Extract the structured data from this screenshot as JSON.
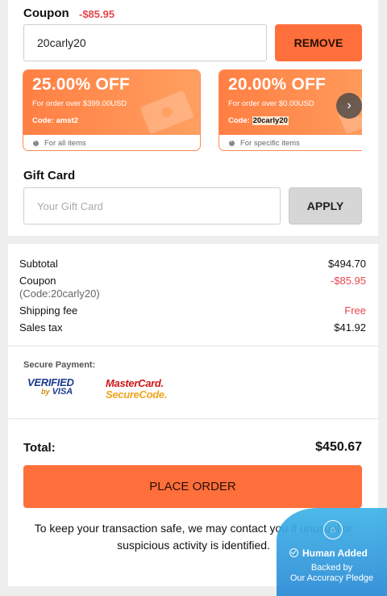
{
  "coupon": {
    "title": "Coupon",
    "discount": "-$85.95",
    "input_value": "20carly20",
    "remove_label": "REMOVE",
    "offers": [
      {
        "percent": "25.00% OFF",
        "condition": "For order over $399.00USD",
        "code_label": "Code:",
        "code": "amst2",
        "scope": "For all items",
        "highlighted": false
      },
      {
        "percent": "20.00% OFF",
        "condition": "For order over $0.00USD",
        "code_label": "Code:",
        "code": "20carly20",
        "scope": "For specific items",
        "highlighted": true
      }
    ],
    "next_icon": "chevron-right-icon"
  },
  "gift_card": {
    "title": "Gift Card",
    "placeholder": "Your Gift Card",
    "apply_label": "APPLY"
  },
  "summary": {
    "subtotal_label": "Subtotal",
    "subtotal_value": "$494.70",
    "coupon_label": "Coupon",
    "coupon_code": "(Code:20carly20)",
    "coupon_value": "-$85.95",
    "shipping_label": "Shipping fee",
    "shipping_value": "Free",
    "tax_label": "Sales tax",
    "tax_value": "$41.92"
  },
  "payment": {
    "secure_label": "Secure Payment:",
    "visa_top": "VERIFIED",
    "visa_by": "by",
    "visa_bot": "VISA",
    "mc_top": "MasterCard.",
    "mc_bot": "SecureCode."
  },
  "total": {
    "label": "Total:",
    "value": "$450.67"
  },
  "place_order_label": "PLACE ORDER",
  "notice": "To keep your transaction safe, we may contact you if unusual or suspicious activity is identified.",
  "badge": {
    "title": "Human Added",
    "line1": "Backed by",
    "line2": "Our Accuracy Pledge"
  },
  "colors": {
    "accent": "#ff6f3c",
    "discount_red": "#e5484d",
    "badge_blue": "#3fb4e8"
  }
}
